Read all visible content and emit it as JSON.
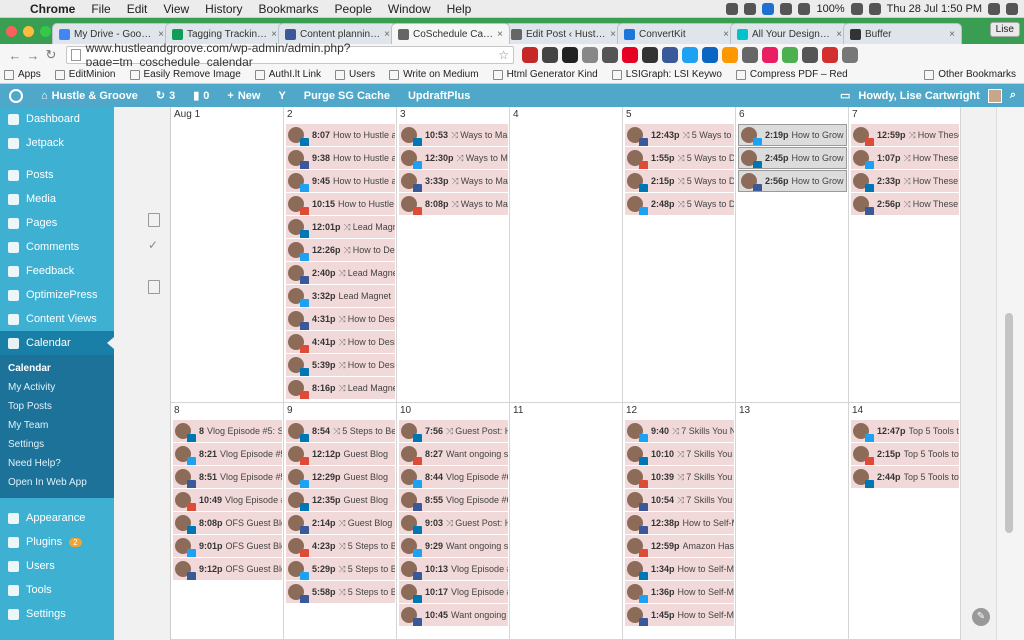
{
  "mac_menu": {
    "app": "Chrome",
    "items": [
      "File",
      "Edit",
      "View",
      "History",
      "Bookmarks",
      "People",
      "Window",
      "Help"
    ],
    "battery": "100%",
    "datetime": "Thu 28 Jul  1:50 PM"
  },
  "tabs": [
    {
      "title": "My Drive - Google D",
      "color": "#4285f4"
    },
    {
      "title": "Tagging Tracking in",
      "color": "#0f9d58"
    },
    {
      "title": "Content planning bo",
      "color": "#3b5998"
    },
    {
      "title": "CoSchedule Calenda",
      "color": "#666666",
      "active": true
    },
    {
      "title": "Edit Post ‹ Hustle &",
      "color": "#666666"
    },
    {
      "title": "ConvertKit",
      "color": "#1d76db"
    },
    {
      "title": "All Your Designs – C",
      "color": "#00c4cc"
    },
    {
      "title": "Buffer",
      "color": "#333333"
    }
  ],
  "profile_button": "Lise",
  "address_bar": {
    "url": "www.hustleandgroove.com/wp-admin/admin.php?page=tm_coschedule_calendar"
  },
  "bookmarks": [
    "Apps",
    "EditMinion",
    "Easily Remove Image",
    "AuthI.lt Link",
    "Users",
    "Write on Medium",
    "Html Generator Kind",
    "LSIGraph: LSI Keywo",
    "Compress PDF – Red"
  ],
  "other_bookmarks": "Other Bookmarks",
  "wp_admin_bar": {
    "site": "Hustle & Groove",
    "updates": "3",
    "comments": "0",
    "new": "New",
    "purge": "Purge SG Cache",
    "updraft": "UpdraftPlus",
    "howdy": "Howdy, Lise Cartwright"
  },
  "sidebar": {
    "top": [
      "Dashboard",
      "Jetpack"
    ],
    "main": [
      "Posts",
      "Media",
      "Pages",
      "Comments",
      "Feedback",
      "OptimizePress",
      "Content Views",
      "Calendar"
    ],
    "submenu": [
      "Calendar",
      "My Activity",
      "Top Posts",
      "My Team",
      "Settings",
      "Need Help?",
      "Open In Web App"
    ],
    "bottom": [
      {
        "label": "Appearance"
      },
      {
        "label": "Plugins",
        "badge": "2"
      },
      {
        "label": "Users"
      },
      {
        "label": "Tools"
      },
      {
        "label": "Settings"
      }
    ]
  },
  "calendar": {
    "week1": [
      {
        "day": "Aug 1",
        "posts": []
      },
      {
        "day": "2",
        "posts": [
          {
            "time": "8:07",
            "title": "How to Hustle a",
            "net": "li"
          },
          {
            "time": "9:38",
            "title": "How to Hustle a",
            "net": "fb"
          },
          {
            "time": "9:45",
            "title": "How to Hustle a",
            "net": "tw"
          },
          {
            "time": "10:15",
            "title": "How to Hustle",
            "net": "gp"
          },
          {
            "time": "12:01p",
            "rt": "⤨",
            "title": "Lead Magn",
            "net": "li"
          },
          {
            "time": "12:26p",
            "rt": "⤨",
            "title": "How to Des",
            "net": "tw"
          },
          {
            "time": "2:40p",
            "rt": "⤨",
            "title": "Lead Magnet",
            "net": "fb"
          },
          {
            "time": "3:32p",
            "title": "Lead Magnet",
            "net": "tw"
          },
          {
            "time": "4:31p",
            "rt": "⤨",
            "title": "How to Desi",
            "net": "fb"
          },
          {
            "time": "4:41p",
            "rt": "⤨",
            "title": "How to Desi",
            "net": "gp"
          },
          {
            "time": "5:39p",
            "rt": "⤨",
            "title": "How to Desi",
            "net": "li"
          },
          {
            "time": "8:16p",
            "rt": "⤨",
            "title": "Lead Magnet",
            "net": "gp"
          }
        ]
      },
      {
        "day": "3",
        "posts": [
          {
            "time": "10:53",
            "rt": "⤨",
            "title": "Ways to Mak",
            "net": "li"
          },
          {
            "time": "12:30p",
            "rt": "⤨",
            "title": "Ways to Ma",
            "net": "tw"
          },
          {
            "time": "3:33p",
            "rt": "⤨",
            "title": "Ways to Mak",
            "net": "fb"
          },
          {
            "time": "8:08p",
            "rt": "⤨",
            "title": "Ways to Mak",
            "net": "gp"
          }
        ]
      },
      {
        "day": "4",
        "posts": []
      },
      {
        "day": "5",
        "posts": [
          {
            "time": "12:43p",
            "rt": "⤨",
            "title": "5 Ways to D",
            "net": "fb"
          },
          {
            "time": "1:55p",
            "rt": "⤨",
            "title": "5 Ways to De",
            "net": "gp"
          },
          {
            "time": "2:15p",
            "rt": "⤨",
            "title": "5 Ways to De",
            "net": "li"
          },
          {
            "time": "2:48p",
            "rt": "⤨",
            "title": "5 Ways to De",
            "net": "tw"
          }
        ]
      },
      {
        "day": "6",
        "posts": [
          {
            "time": "2:19p",
            "title": "How to Grow Y",
            "net": "tw",
            "sel": true
          },
          {
            "time": "2:45p",
            "title": "How to Grow Y",
            "net": "li",
            "sel": true
          },
          {
            "time": "2:56p",
            "title": "How to Grow Y",
            "net": "fb",
            "sel": true
          }
        ]
      },
      {
        "day": "7",
        "posts": [
          {
            "time": "12:59p",
            "rt": "⤨",
            "title": "How These",
            "net": "gp"
          },
          {
            "time": "1:07p",
            "rt": "⤨",
            "title": "How These S",
            "net": "tw"
          },
          {
            "time": "2:33p",
            "rt": "⤨",
            "title": "How These S",
            "net": "li"
          },
          {
            "time": "2:56p",
            "rt": "⤨",
            "title": "How These S",
            "net": "fb"
          }
        ]
      }
    ],
    "week2": [
      {
        "day": "8",
        "posts": [
          {
            "time": "8",
            "title": "Vlog Episode #5: Si",
            "net": "li"
          },
          {
            "time": "8:21",
            "title": "Vlog Episode #5:",
            "net": "tw"
          },
          {
            "time": "8:51",
            "title": "Vlog Episode #5:",
            "net": "fb"
          },
          {
            "time": "10:49",
            "title": "Vlog Episode #",
            "net": "gp"
          },
          {
            "time": "8:08p",
            "title": "OFS Guest Blo",
            "net": "li"
          },
          {
            "time": "9:01p",
            "title": "OFS Guest Blo",
            "net": "tw"
          },
          {
            "time": "9:12p",
            "title": "OFS Guest Blo",
            "net": "fb"
          }
        ]
      },
      {
        "day": "9",
        "posts": [
          {
            "time": "8:54",
            "rt": "⤨",
            "title": "5 Steps to Bet",
            "net": "li"
          },
          {
            "time": "12:12p",
            "title": "Guest Blog",
            "net": "gp"
          },
          {
            "time": "12:29p",
            "title": "Guest Blog",
            "net": "tw"
          },
          {
            "time": "12:35p",
            "title": "Guest Blog",
            "net": "li"
          },
          {
            "time": "2:14p",
            "rt": "⤨",
            "title": "Guest Blog P",
            "net": "fb"
          },
          {
            "time": "4:23p",
            "rt": "⤨",
            "title": "5 Steps to B",
            "net": "gp"
          },
          {
            "time": "5:29p",
            "rt": "⤨",
            "title": "5 Steps to B",
            "net": "tw"
          },
          {
            "time": "5:58p",
            "rt": "⤨",
            "title": "5 Steps to B",
            "net": "fb"
          }
        ]
      },
      {
        "day": "10",
        "posts": [
          {
            "time": "7:56",
            "rt": "⤨",
            "title": "Guest Post: H",
            "net": "li"
          },
          {
            "time": "8:27",
            "title": "Want ongoing su",
            "net": "gp"
          },
          {
            "time": "8:44",
            "title": "Vlog Episode #6:",
            "net": "tw"
          },
          {
            "time": "8:55",
            "title": "Vlog Episode #6:",
            "net": "fb"
          },
          {
            "time": "9:03",
            "rt": "⤨",
            "title": "Guest Post: H",
            "net": "li"
          },
          {
            "time": "9:29",
            "title": "Want ongoing su",
            "net": "tw"
          },
          {
            "time": "10:13",
            "title": "Vlog Episode #",
            "net": "fb"
          },
          {
            "time": "10:17",
            "title": "Vlog Episode #",
            "net": "li"
          },
          {
            "time": "10:45",
            "title": "Want ongoing s",
            "net": "fb"
          }
        ]
      },
      {
        "day": "11",
        "posts": []
      },
      {
        "day": "12",
        "posts": [
          {
            "time": "9:40",
            "rt": "⤨",
            "title": "7 Skills You N",
            "net": "tw"
          },
          {
            "time": "10:10",
            "rt": "⤨",
            "title": "7 Skills You",
            "net": "li"
          },
          {
            "time": "10:39",
            "rt": "⤨",
            "title": "7 Skills You",
            "net": "gp"
          },
          {
            "time": "10:54",
            "rt": "⤨",
            "title": "7 Skills You",
            "net": "fb"
          },
          {
            "time": "12:38p",
            "title": "How to Self-M",
            "net": "fb"
          },
          {
            "time": "12:59p",
            "title": "Amazon Has",
            "net": "gp"
          },
          {
            "time": "1:34p",
            "title": "How to Self-Mo",
            "net": "li"
          },
          {
            "time": "1:36p",
            "title": "How to Self-Mo",
            "net": "tw"
          },
          {
            "time": "1:45p",
            "title": "How to Self-Mo",
            "net": "fb"
          }
        ]
      },
      {
        "day": "13",
        "posts": []
      },
      {
        "day": "14",
        "posts": [
          {
            "time": "12:47p",
            "title": "Top 5 Tools to",
            "net": "tw"
          },
          {
            "time": "2:15p",
            "title": "Top 5 Tools to",
            "net": "gp"
          },
          {
            "time": "2:44p",
            "title": "Top 5 Tools to",
            "net": "li"
          }
        ]
      }
    ]
  }
}
